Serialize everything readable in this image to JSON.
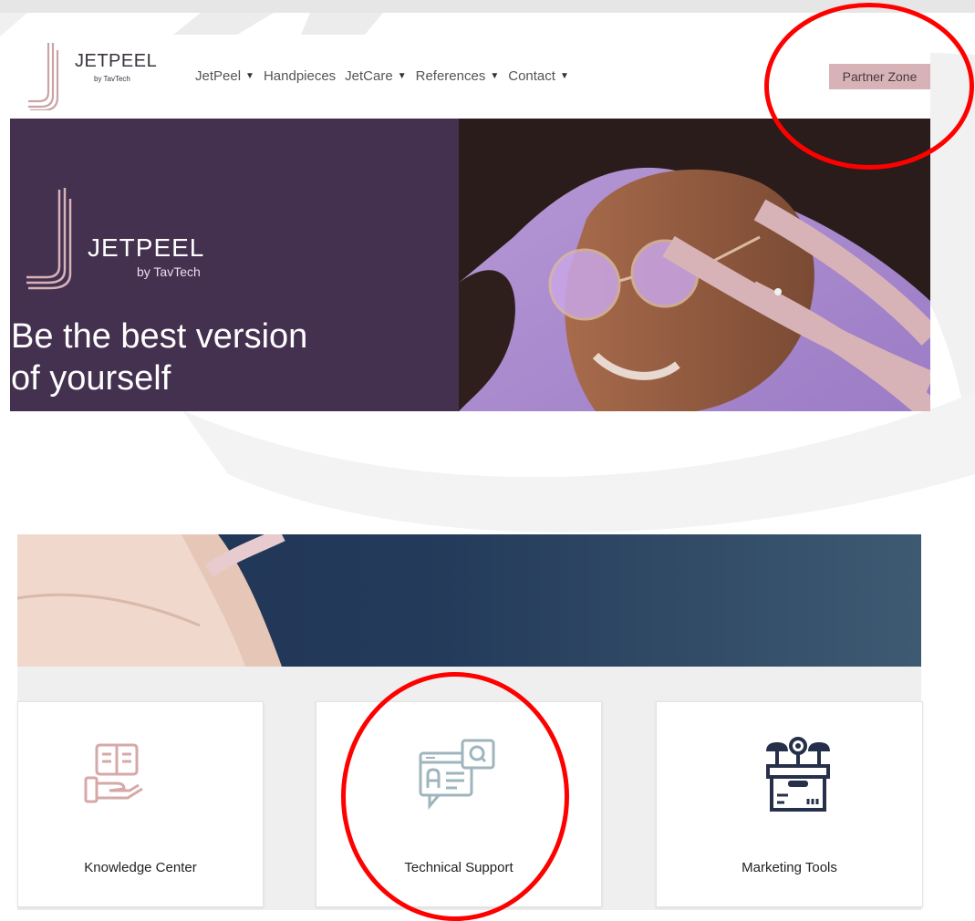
{
  "navbar": {
    "logo_title": "JETPEEL",
    "logo_subtitle": "by TavTech",
    "menu": [
      {
        "label": "JetPeel",
        "has_caret": true
      },
      {
        "label": "Handpieces",
        "has_caret": false
      },
      {
        "label": "JetCare",
        "has_caret": true
      },
      {
        "label": "References",
        "has_caret": true
      },
      {
        "label": "Contact",
        "has_caret": true
      }
    ],
    "partner_zone": "Partner Zone"
  },
  "hero": {
    "logo_title": "JETPEEL",
    "logo_subtitle": "by TavTech",
    "tagline_line1": "Be the best version",
    "tagline_line2": "of yourself"
  },
  "cards": [
    {
      "label": "Knowledge Center",
      "icon": "book-hand-icon"
    },
    {
      "label": "Technical Support",
      "icon": "chat-search-icon"
    },
    {
      "label": "Marketing Tools",
      "icon": "box-network-icon"
    }
  ],
  "colors": {
    "brand_purple": "#44304f",
    "brand_pink": "#d7b3b7",
    "annotation_red": "#ff0000",
    "banner_navy": "#223556"
  }
}
